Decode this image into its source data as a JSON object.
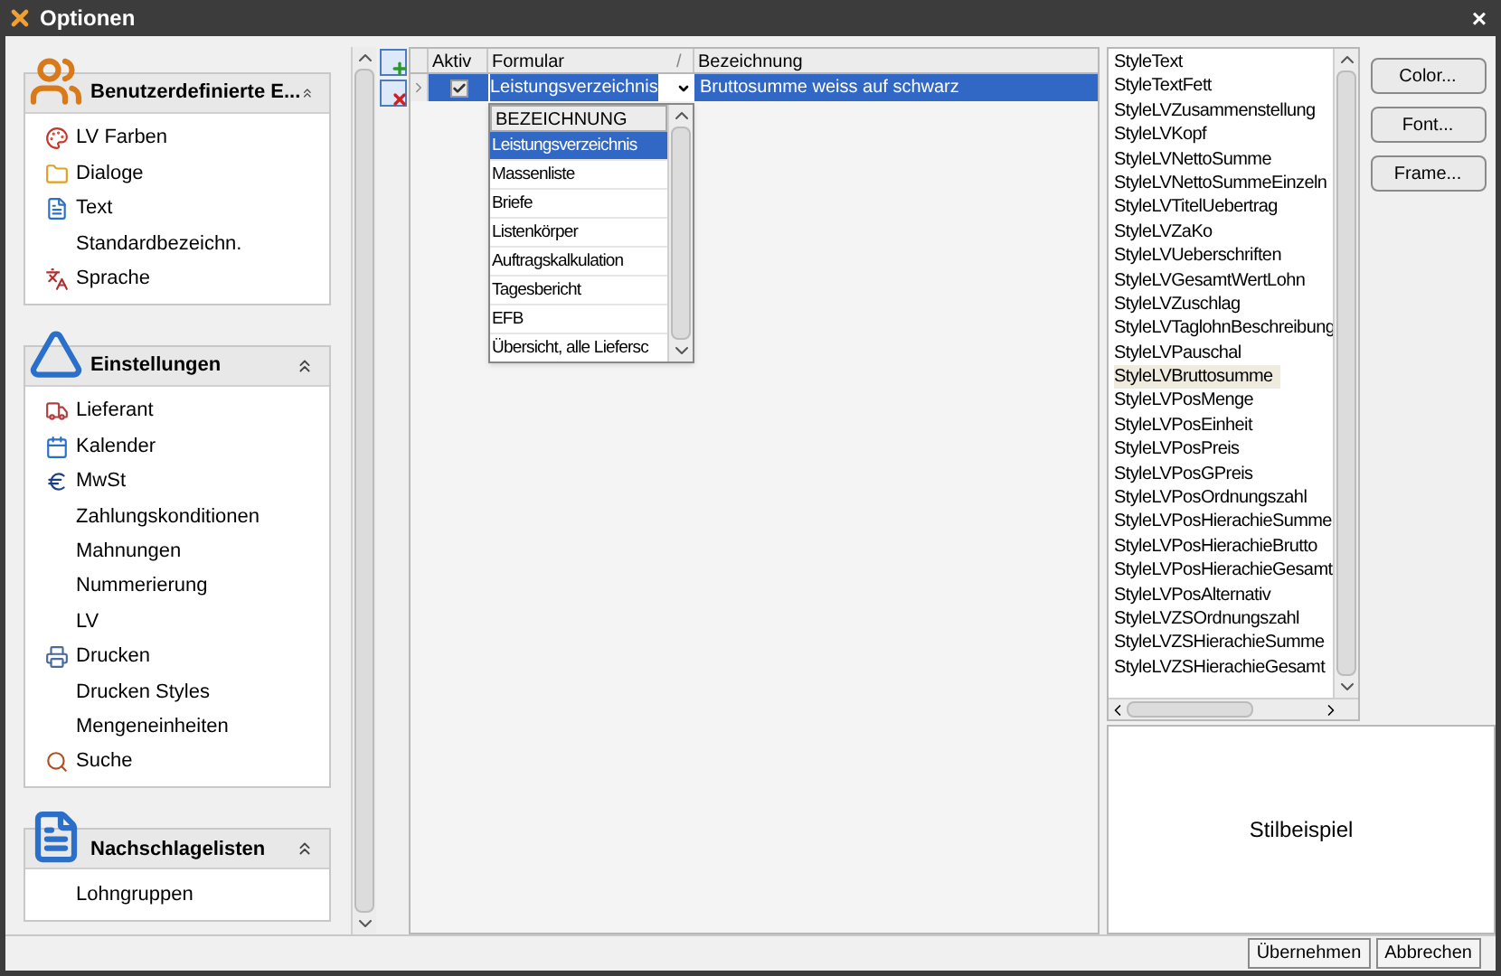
{
  "window": {
    "title": "Optionen",
    "close": "×"
  },
  "sidebar": {
    "groups": [
      {
        "title": "Benutzerdefinierte E...",
        "expanded": true,
        "items": [
          {
            "label": "LV Farben"
          },
          {
            "label": "Dialoge"
          },
          {
            "label": "Text"
          },
          {
            "label": "Standardbezeichn."
          },
          {
            "label": "Sprache"
          }
        ]
      },
      {
        "title": "Einstellungen",
        "expanded": true,
        "items": [
          {
            "label": "Lieferant"
          },
          {
            "label": "Kalender"
          },
          {
            "label": "MwSt"
          },
          {
            "label": "Zahlungskonditionen"
          },
          {
            "label": "Mahnungen"
          },
          {
            "label": "Nummerierung"
          },
          {
            "label": "LV"
          },
          {
            "label": "Drucken"
          },
          {
            "label": "Drucken Styles"
          },
          {
            "label": "Mengeneinheiten"
          },
          {
            "label": "Suche"
          }
        ]
      },
      {
        "title": "Nachschlagelisten",
        "expanded": true,
        "items": [
          {
            "label": "Lohngruppen"
          }
        ]
      }
    ]
  },
  "grid": {
    "columns": [
      "Aktiv",
      "Formular",
      "Bezeichnung"
    ],
    "sort_mark": "/",
    "rows": [
      {
        "selected": true,
        "aktiv": true,
        "formular": "Leistungsverzeichnis",
        "bezeichnung": "Bruttosumme weiss auf schwarz"
      }
    ]
  },
  "dropdown": {
    "header": "BEZEICHNUNG",
    "options": [
      {
        "label": "Leistungsverzeichnis",
        "selected": true
      },
      {
        "label": "Massenliste",
        "selected": false
      },
      {
        "label": "Briefe",
        "selected": false
      },
      {
        "label": "Listenkörper",
        "selected": false
      },
      {
        "label": "Auftragskalkulation",
        "selected": false
      },
      {
        "label": "Tagesbericht",
        "selected": false
      },
      {
        "label": "EFB",
        "selected": false
      },
      {
        "label": "Übersicht, alle Liefersc",
        "selected": false
      }
    ]
  },
  "styles": {
    "items": [
      {
        "label": "StyleText",
        "selected": false
      },
      {
        "label": "StyleTextFett",
        "selected": false
      },
      {
        "label": "StyleLVZusammenstellung",
        "selected": false
      },
      {
        "label": "StyleLVKopf",
        "selected": false
      },
      {
        "label": "StyleLVNettoSumme",
        "selected": false
      },
      {
        "label": "StyleLVNettoSummeEinzeln",
        "selected": false
      },
      {
        "label": "StyleLVTitelUebertrag",
        "selected": false
      },
      {
        "label": "StyleLVZaKo",
        "selected": false
      },
      {
        "label": "StyleLVUeberschriften",
        "selected": false
      },
      {
        "label": "StyleLVGesamtWertLohn",
        "selected": false
      },
      {
        "label": "StyleLVZuschlag",
        "selected": false
      },
      {
        "label": "StyleLVTaglohnBeschreibung",
        "selected": false
      },
      {
        "label": "StyleLVPauschal",
        "selected": false
      },
      {
        "label": "StyleLVBruttosumme",
        "selected": true
      },
      {
        "label": "StyleLVPosMenge",
        "selected": false
      },
      {
        "label": "StyleLVPosEinheit",
        "selected": false
      },
      {
        "label": "StyleLVPosPreis",
        "selected": false
      },
      {
        "label": "StyleLVPosGPreis",
        "selected": false
      },
      {
        "label": "StyleLVPosOrdnungszahl",
        "selected": false
      },
      {
        "label": "StyleLVPosHierachieSumme",
        "selected": false
      },
      {
        "label": "StyleLVPosHierachieBrutto",
        "selected": false
      },
      {
        "label": "StyleLVPosHierachieGesamt",
        "selected": false
      },
      {
        "label": "StyleLVPosAlternativ",
        "selected": false
      },
      {
        "label": "StyleLVZSOrdnungszahl",
        "selected": false
      },
      {
        "label": "StyleLVZSHierachieSumme",
        "selected": false
      },
      {
        "label": "StyleLVZSHierachieGesamt",
        "selected": false
      }
    ]
  },
  "style_buttons": [
    "Color...",
    "Font...",
    "Frame..."
  ],
  "preview": {
    "text": "Stilbeispiel"
  },
  "footer": {
    "buttons": [
      "Übernehmen",
      "Abbrechen"
    ]
  }
}
